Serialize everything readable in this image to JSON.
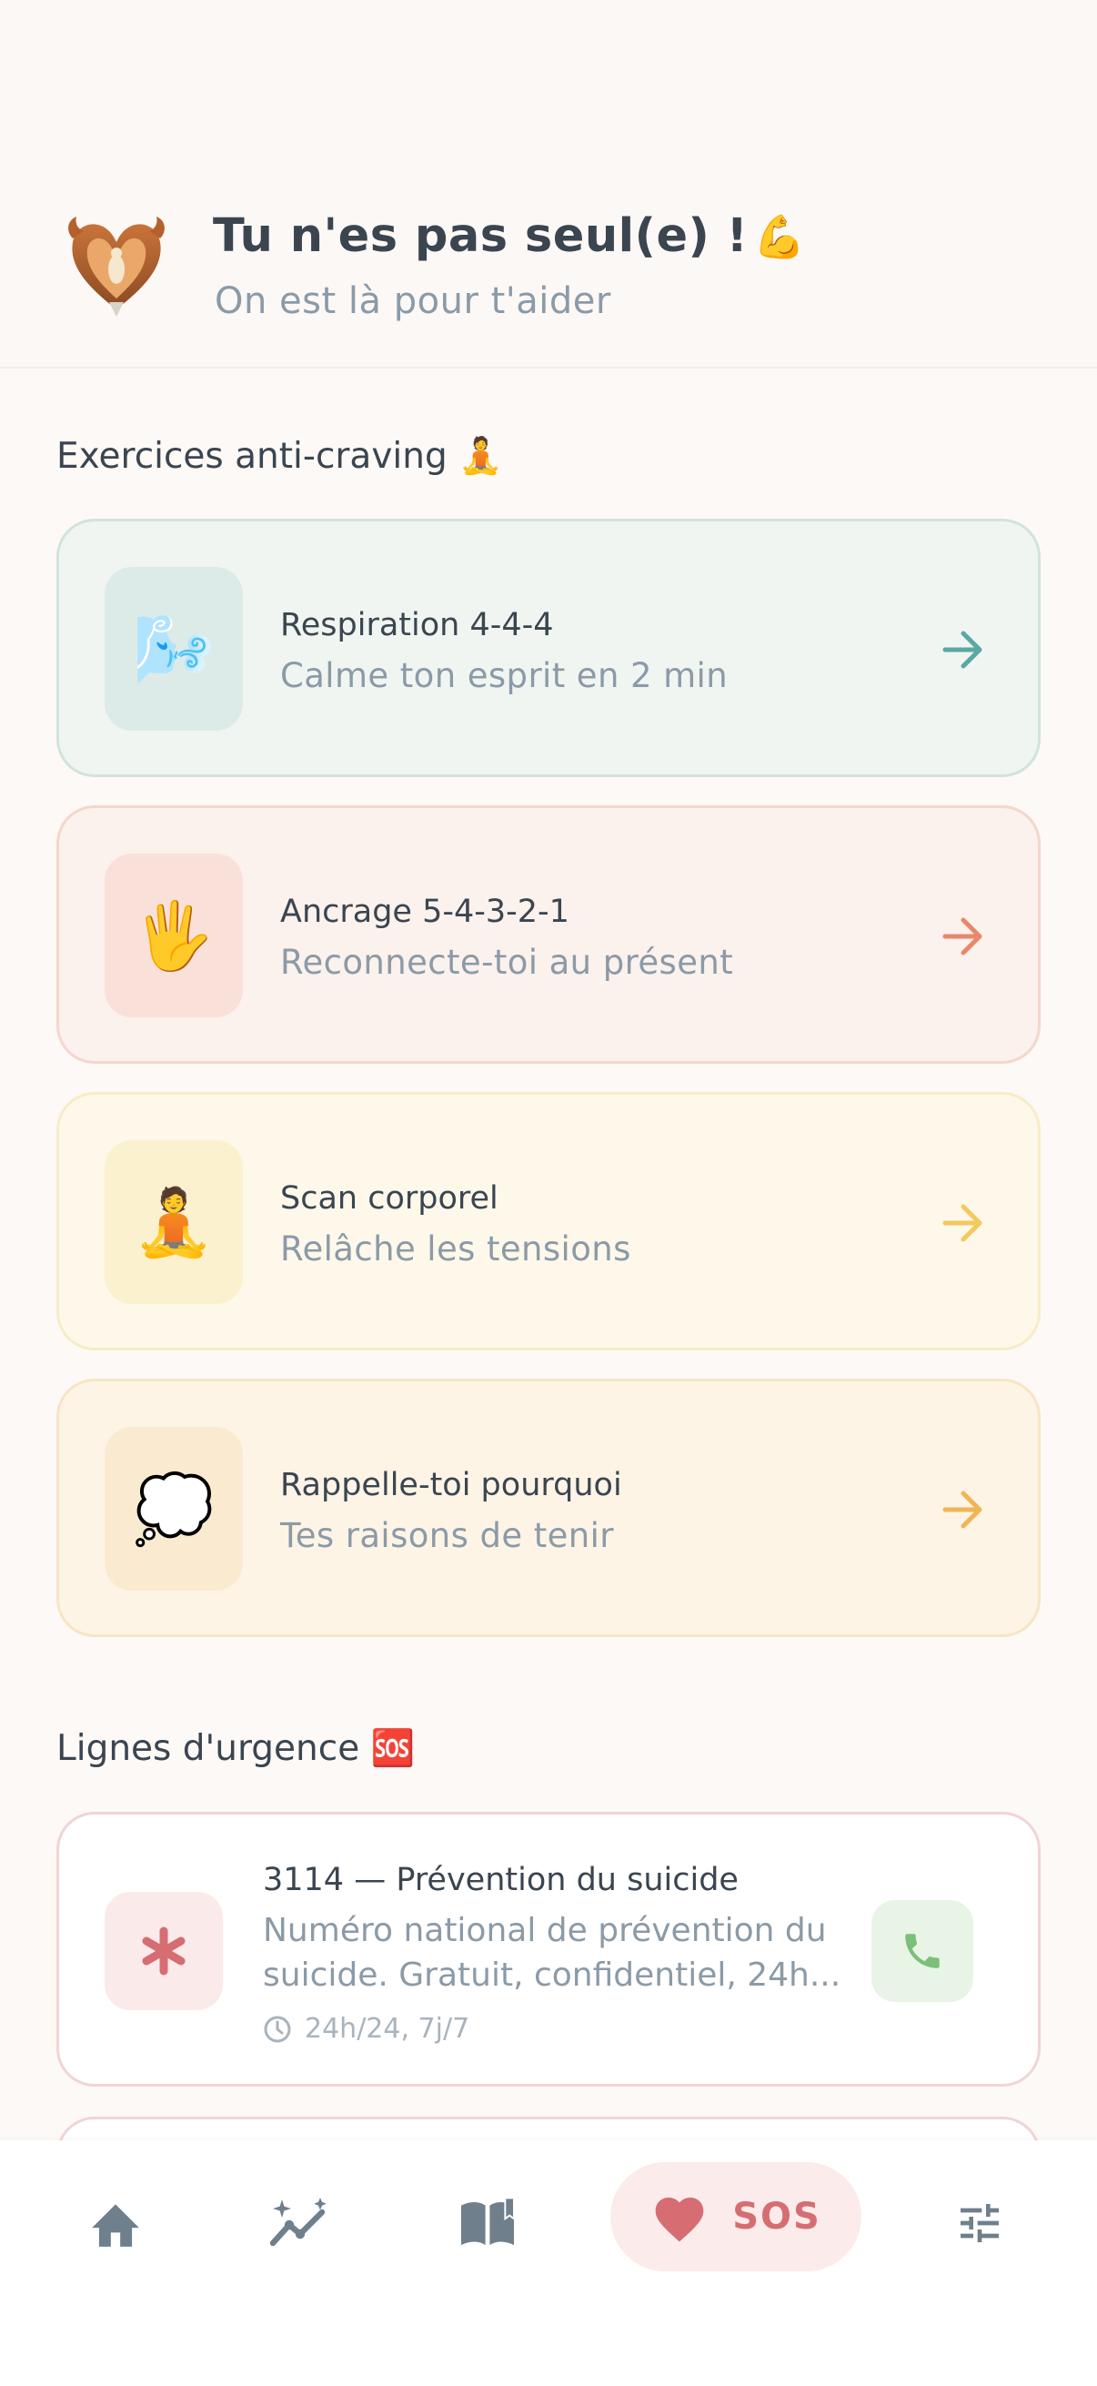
{
  "header": {
    "title": "Tu n'es pas seul(e) !",
    "title_emoji": "💪",
    "subtitle": "On est là pour t'aider",
    "logo_icon": "winged-heart-logo"
  },
  "exercises": {
    "section_title": "Exercices anti-craving",
    "section_emoji": "🧘",
    "items": [
      {
        "title": "Respiration 4-4-4",
        "subtitle": "Calme ton esprit en 2 min",
        "icon": "🌬️",
        "accent": "#5aa8a2",
        "bg": "#f1f5f1",
        "border": "#cfe4dd",
        "icon_bg": "#dcebe7"
      },
      {
        "title": "Ancrage 5-4-3-2-1",
        "subtitle": "Reconnecte-toi au présent",
        "icon": "🖐",
        "accent": "#e8886a",
        "bg": "#fbf1ed",
        "border": "#f5d6cc",
        "icon_bg": "#f9e1da"
      },
      {
        "title": "Scan corporel",
        "subtitle": "Relâche les tensions",
        "icon": "🧘",
        "accent": "#f3c85d",
        "bg": "#fef8ea",
        "border": "#f8ecc6",
        "icon_bg": "#fcf1cf"
      },
      {
        "title": "Rappelle-toi pourquoi",
        "subtitle": "Tes raisons de tenir",
        "icon": "💭",
        "accent": "#f0b556",
        "bg": "#fdf4e6",
        "border": "#f7e5c4",
        "icon_bg": "#faebd0"
      }
    ]
  },
  "emergency": {
    "section_title": "Lignes d'urgence",
    "section_emoji": "🆘",
    "lines": [
      {
        "title": "3114 — Prévention du suicide",
        "description_line1": "Numéro national de prévention du",
        "description_line2": "suicide. Gratuit, confidentiel, 24h...",
        "hours": "24h/24, 7j/7",
        "icon": "asterisk-icon",
        "accent": "#d66d72"
      }
    ]
  },
  "nav": {
    "sos_label": "SOS",
    "active": "sos"
  }
}
